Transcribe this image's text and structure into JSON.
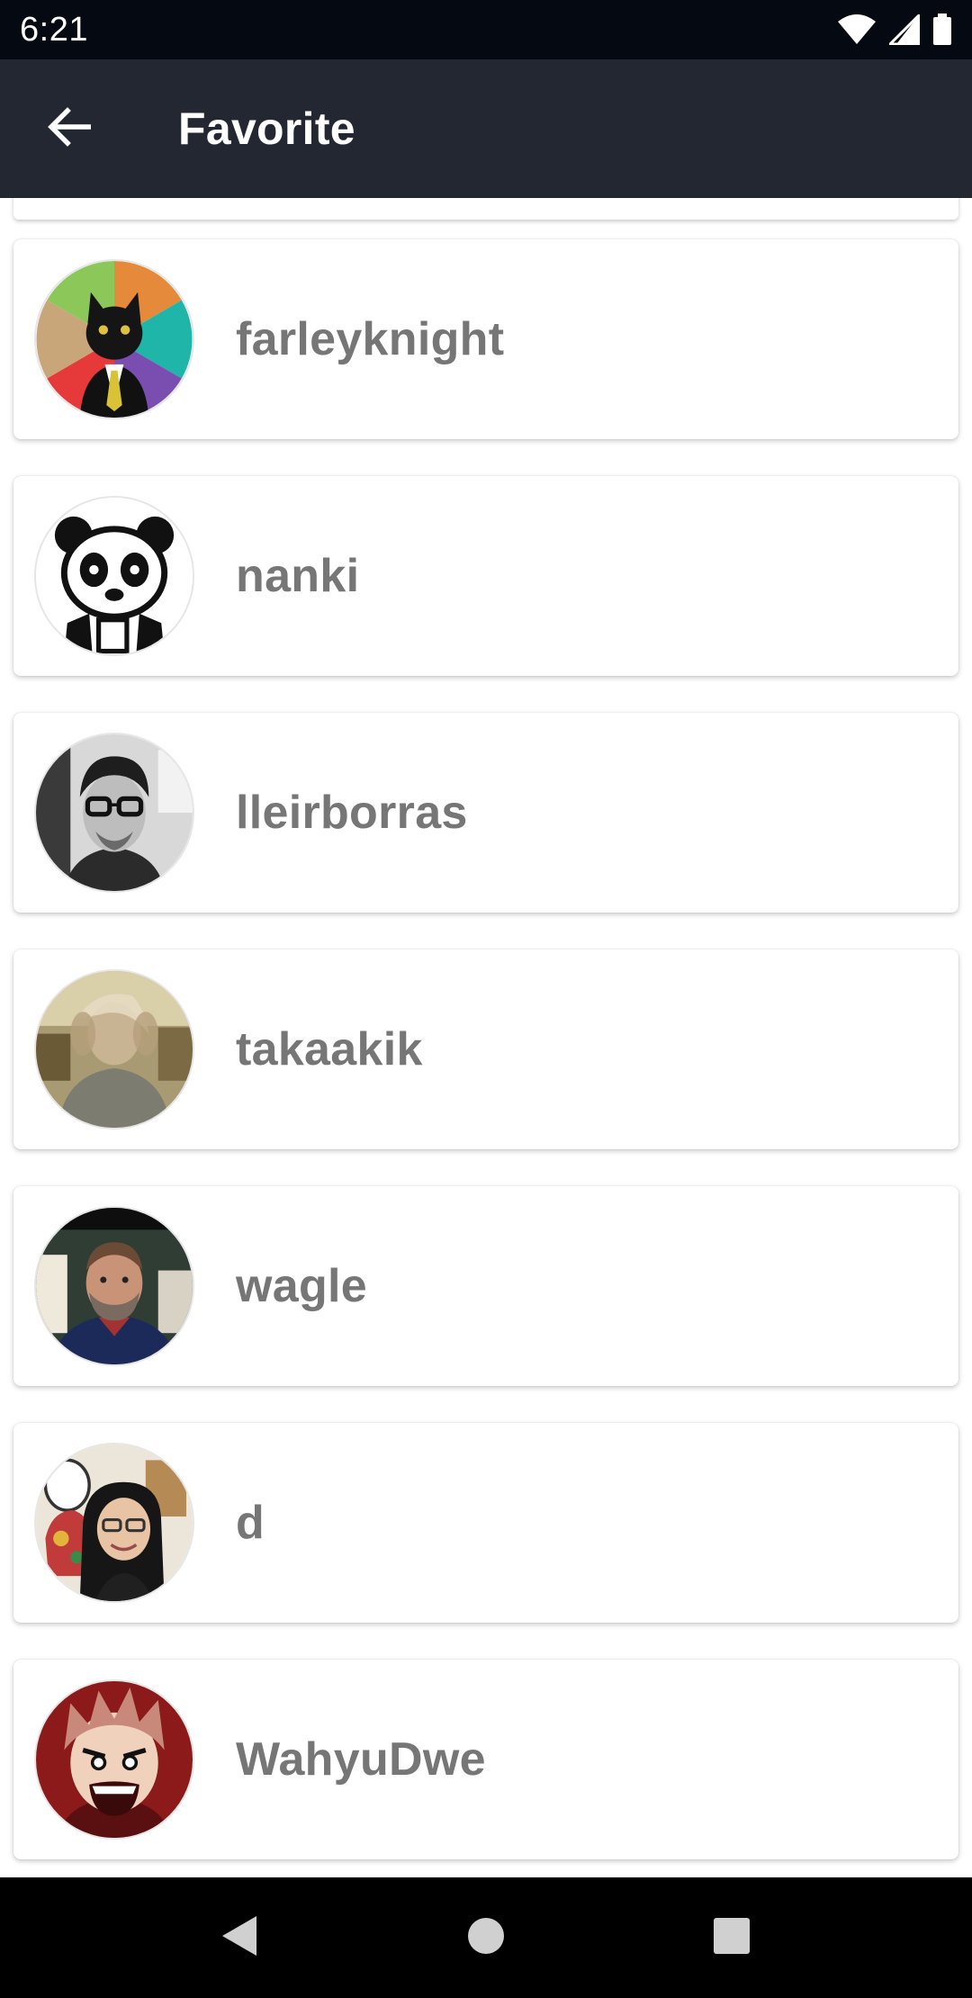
{
  "status_bar": {
    "time": "6:21",
    "icons": [
      "wifi-icon",
      "signal-icon",
      "battery-icon"
    ]
  },
  "app_bar": {
    "back_icon": "arrow-left-icon",
    "title": "Favorite"
  },
  "favorites": [
    {
      "username": "farleyknight",
      "avatar": "cat-in-suit-avatar"
    },
    {
      "username": "nanki",
      "avatar": "panda-avatar"
    },
    {
      "username": "lleirborras",
      "avatar": "man-glasses-avatar"
    },
    {
      "username": "takaakik",
      "avatar": "blurred-person-avatar"
    },
    {
      "username": "wagle",
      "avatar": "bearded-man-avatar"
    },
    {
      "username": "d",
      "avatar": "woman-glasses-avatar"
    },
    {
      "username": "WahyuDwe",
      "avatar": "anime-character-avatar"
    }
  ],
  "nav_bar": {
    "back_icon": "triangle-back-icon",
    "home_icon": "circle-home-icon",
    "recents_icon": "square-recents-icon"
  },
  "colors": {
    "status_bar": "#050a12",
    "app_bar": "#222731",
    "username_text": "#767676",
    "card_background": "#ffffff"
  }
}
